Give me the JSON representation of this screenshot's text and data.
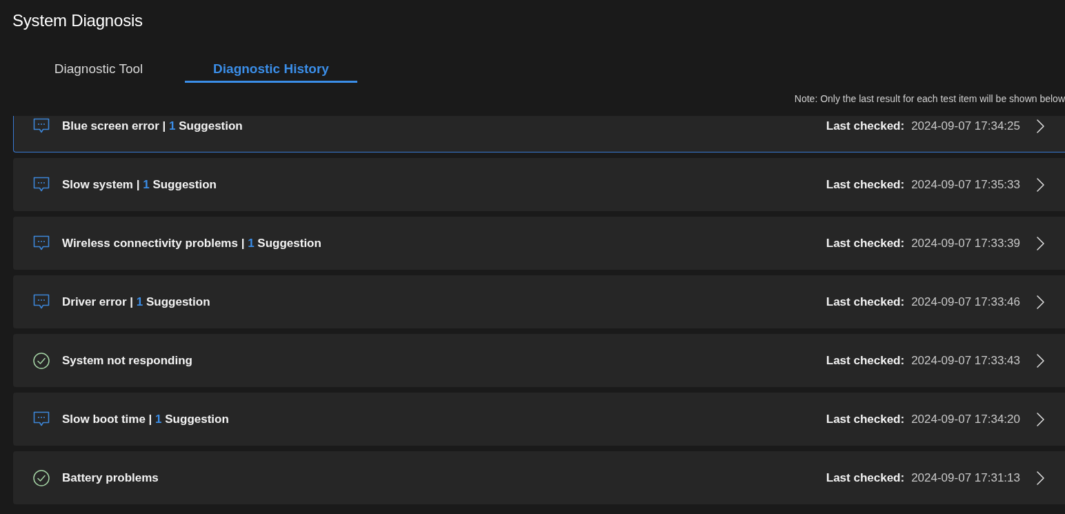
{
  "window": {
    "title": "System Diagnosis"
  },
  "tabs": [
    {
      "label": "Diagnostic Tool",
      "selected": false
    },
    {
      "label": "Diagnostic History",
      "selected": true
    }
  ],
  "note": "Note: Only the last result for each test item will be shown below",
  "items": [
    {
      "kind": "suggestion",
      "title": "Blue screen error",
      "separator": "|",
      "count": "1",
      "count_label": "Suggestion",
      "last_checked_label": "Last checked:",
      "last_checked": "2024-09-07 17:34:25",
      "selected": true
    },
    {
      "kind": "suggestion",
      "title": "Slow system",
      "separator": "|",
      "count": "1",
      "count_label": "Suggestion",
      "last_checked_label": "Last checked:",
      "last_checked": "2024-09-07 17:35:33",
      "selected": false
    },
    {
      "kind": "suggestion",
      "title": "Wireless connectivity problems",
      "separator": "|",
      "count": "1",
      "count_label": "Suggestion",
      "last_checked_label": "Last checked:",
      "last_checked": "2024-09-07 17:33:39",
      "selected": false
    },
    {
      "kind": "suggestion",
      "title": "Driver error",
      "separator": "|",
      "count": "1",
      "count_label": "Suggestion",
      "last_checked_label": "Last checked:",
      "last_checked": "2024-09-07 17:33:46",
      "selected": false
    },
    {
      "kind": "passed",
      "title": "System not responding",
      "last_checked_label": "Last checked:",
      "last_checked": "2024-09-07 17:33:43",
      "selected": false
    },
    {
      "kind": "suggestion",
      "title": "Slow boot time",
      "separator": "|",
      "count": "1",
      "count_label": "Suggestion",
      "last_checked_label": "Last checked:",
      "last_checked": "2024-09-07 17:34:20",
      "selected": false
    },
    {
      "kind": "passed",
      "title": "Battery problems",
      "last_checked_label": "Last checked:",
      "last_checked": "2024-09-07 17:31:13",
      "selected": false
    }
  ]
}
